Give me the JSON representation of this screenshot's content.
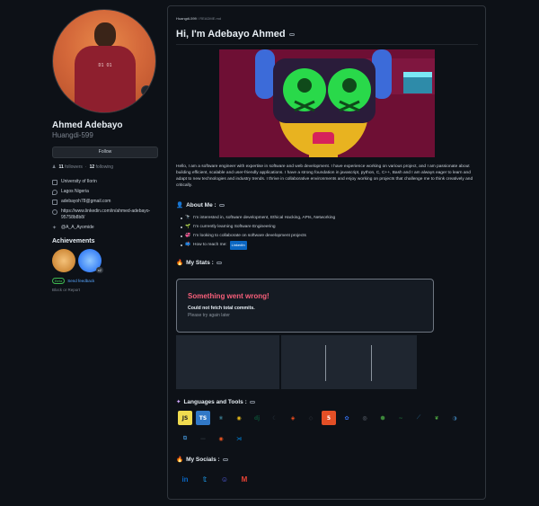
{
  "profile": {
    "fullname": "Ahmed Adebayo",
    "username": "Huangdi-599",
    "follow_label": "Follow",
    "followers_count": "11",
    "followers_label": "followers",
    "separator": "·",
    "following_count": "12",
    "following_label": "following",
    "shirt_text": "D1 O1",
    "details": [
      {
        "icon": "organization-icon",
        "text": "University of Ilorin"
      },
      {
        "icon": "location-icon",
        "text": "Lagos Nigeria"
      },
      {
        "icon": "mail-icon",
        "text": "adebayoh78@gmail.com"
      },
      {
        "icon": "link-icon",
        "text": "https://www.linkedin.com/in/ahmed-adebayo-95758b8b8/"
      },
      {
        "icon": "twitter-icon",
        "text": "@A_A_Ayomide"
      }
    ],
    "achievements_title": "Achievements",
    "achievement_badge_count": "x2",
    "beta_label": "Beta",
    "beta_text": "Send feedback",
    "block_report": "Block or Report"
  },
  "readme": {
    "crumb_repo": "Huangdi-599",
    "crumb_file": "/ README.md",
    "title": "Hi, I'm Adebayo Ahmed",
    "intro": "Hello, I am a software engineer with expertise in software and web development. I have experience working on various project, and I am passionate about building efficient, scalable and user-friendly applications. I have a strong foundation in javascript, python, C, C++, Bash and I am always eager to learn and adapt to new technologies and industry trends. I thrive in collaborative environments and enjoy working on projects that challenge me to think creatively and critically.",
    "about_title": "About Me :",
    "about_items": [
      {
        "emoji": "🔭",
        "text": "I'm interested in, software development, Ethical Hacking, APIs, Networking"
      },
      {
        "emoji": "🌱",
        "text": "I'm currently learning Software Engineering"
      },
      {
        "emoji": "💞",
        "text": "I'm looking to collaborate on software development projects"
      },
      {
        "emoji": "📫",
        "text": "How to reach me:"
      }
    ],
    "linkedin_badge": "LinkedIn",
    "stats_title": "My Stats :",
    "error_title": "Something went wrong!",
    "error_message": "Could not fetch total commits.",
    "error_sub": "Please try again later",
    "languages_title": "Languages and Tools :",
    "socials_title": "My Socials :",
    "tech_row1": [
      {
        "icon": "javascript-icon",
        "glyph": "JS",
        "bg": "#f0db4f",
        "fg": "#222222"
      },
      {
        "icon": "typescript-icon",
        "glyph": "TS",
        "bg": "#3178c6",
        "fg": "#ffffff"
      },
      {
        "icon": "react-icon",
        "glyph": "⚛",
        "bg": "transparent",
        "fg": "#61dafb"
      },
      {
        "icon": "redux-icon",
        "glyph": "◉",
        "bg": "transparent",
        "fg": "#e5b91a"
      },
      {
        "icon": "django-icon",
        "glyph": "dj",
        "bg": "transparent",
        "fg": "#0c4b33"
      },
      {
        "icon": "terminal-icon",
        "glyph": "☾",
        "bg": "transparent",
        "fg": "#2d3b45"
      },
      {
        "icon": "figma-icon",
        "glyph": "◈",
        "bg": "transparent",
        "fg": "#f24e1e"
      },
      {
        "icon": "git-icon",
        "glyph": "◇",
        "bg": "transparent",
        "fg": "#30363d"
      },
      {
        "icon": "html5-icon",
        "glyph": "5",
        "bg": "#e34f26",
        "fg": "#ffffff"
      },
      {
        "icon": "kubernetes-icon",
        "glyph": "✿",
        "bg": "transparent",
        "fg": "#326ce5"
      },
      {
        "icon": "linux-icon",
        "glyph": "◎",
        "bg": "transparent",
        "fg": "#6e7681"
      },
      {
        "icon": "nodejs-icon",
        "glyph": "⬢",
        "bg": "transparent",
        "fg": "#3c873a"
      },
      {
        "icon": "nginx-icon",
        "glyph": "~",
        "bg": "transparent",
        "fg": "#1f6a36"
      },
      {
        "icon": "mysql-icon",
        "glyph": "⟋",
        "bg": "transparent",
        "fg": "#1e4966"
      },
      {
        "icon": "mongodb-icon",
        "glyph": "❦",
        "bg": "transparent",
        "fg": "#4faa41"
      },
      {
        "icon": "postgresql-icon",
        "glyph": "◑",
        "bg": "transparent",
        "fg": "#336791"
      }
    ],
    "tech_row2": [
      {
        "icon": "python-icon",
        "glyph": "⧉",
        "bg": "transparent",
        "fg": "#3776ab"
      },
      {
        "icon": "sqlite-icon",
        "glyph": "—",
        "bg": "transparent",
        "fg": "#30363d"
      },
      {
        "icon": "ubuntu-icon",
        "glyph": "◉",
        "bg": "transparent",
        "fg": "#e95420"
      },
      {
        "icon": "vscode-icon",
        "glyph": "⋊",
        "bg": "transparent",
        "fg": "#007acc"
      }
    ],
    "socials": [
      {
        "icon": "linkedin-icon",
        "glyph": "in",
        "fg": "#0a66c2"
      },
      {
        "icon": "twitter-icon",
        "glyph": "𝕥",
        "fg": "#1da1f2"
      },
      {
        "icon": "discord-icon",
        "glyph": "☺",
        "fg": "#5865f2"
      },
      {
        "icon": "gmail-icon",
        "glyph": "M",
        "fg": "#ea4335"
      }
    ]
  }
}
